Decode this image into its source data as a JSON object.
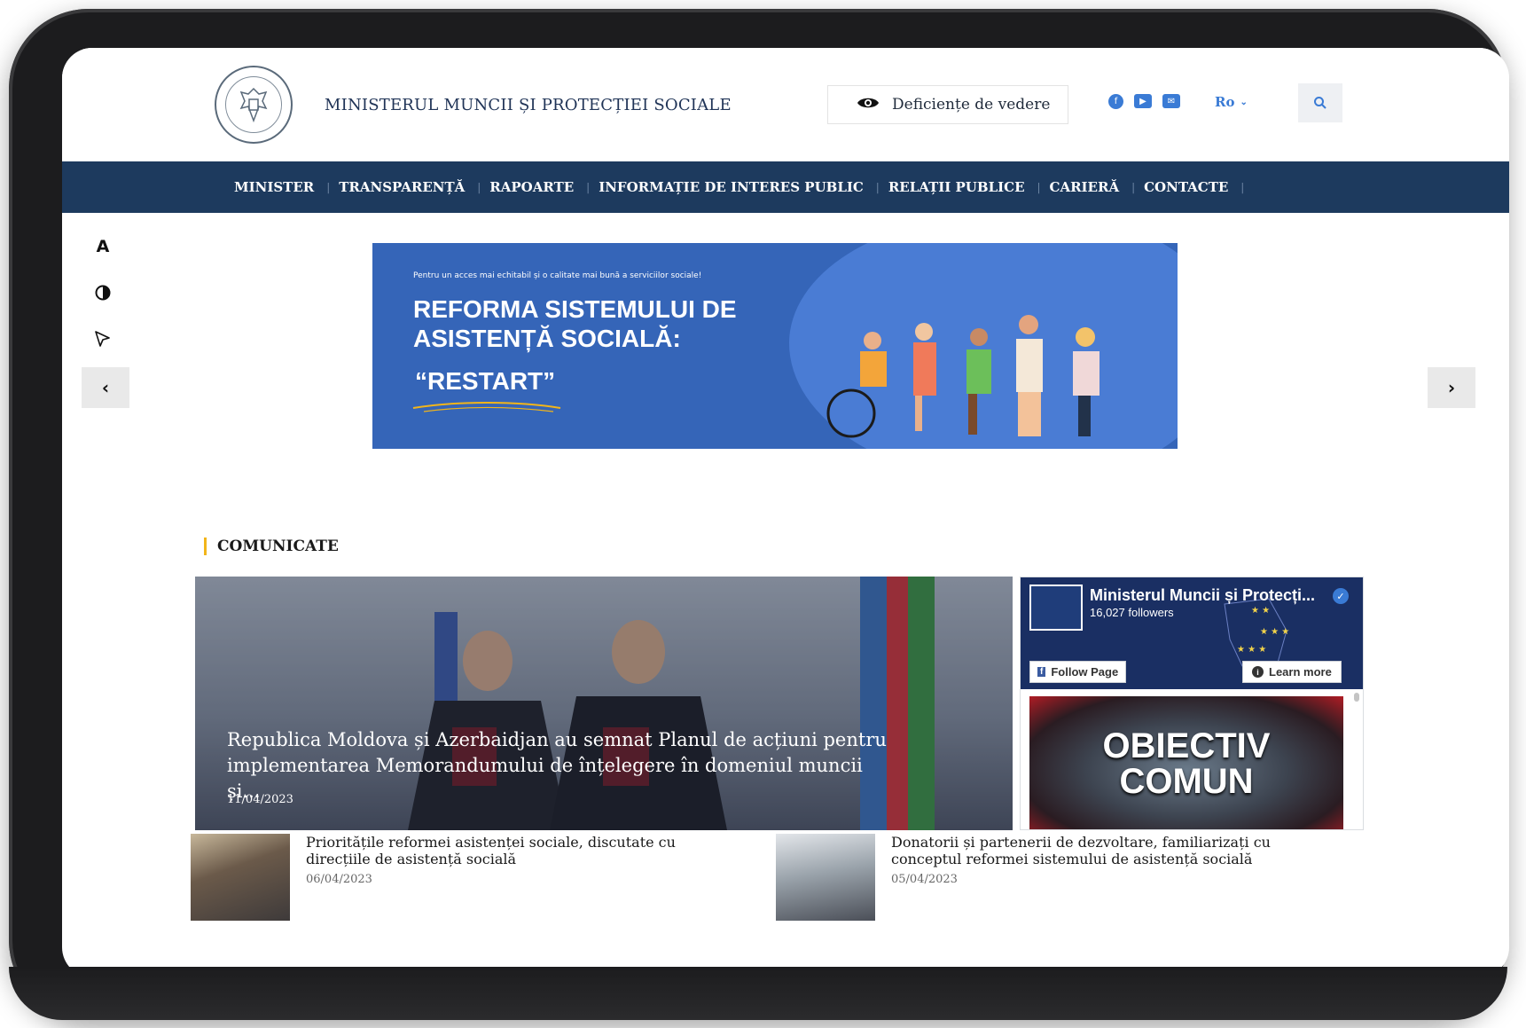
{
  "header": {
    "site_title": "MINISTERUL MUNCII ȘI PROTECȚIEI SOCIALE",
    "vision_label": "Deficiențe de vedere",
    "language": "Ro"
  },
  "nav": {
    "items": [
      "MINISTER",
      "TRANSPARENȚĂ",
      "RAPOARTE",
      "INFORMAȚIE DE INTERES PUBLIC",
      "RELAȚII PUBLICE",
      "CARIERĂ",
      "CONTACTE"
    ]
  },
  "tools": {
    "font_label": "A"
  },
  "banner": {
    "small_text": "Pentru un acces mai echitabil și o calitate mai bună a serviciilor sociale!",
    "title": "REFORMA SISTEMULUI DE ASISTENȚĂ SOCIALĂ:",
    "subtitle": "“RESTART”"
  },
  "section": {
    "title": "COMUNICATE"
  },
  "featured": {
    "title": "Republica Moldova și Azerbaidjan au semnat Planul de acțiuni pentru implementarea Memorandumului de înțelegere în domeniul muncii și...",
    "date": "11/04/2023"
  },
  "facebook": {
    "page_name": "Ministerul Muncii și Protecți...",
    "followers": "16,027 followers",
    "follow_label": "Follow Page",
    "learn_label": "Learn more",
    "video_line1": "OBIECTIV",
    "video_line2": "COMUN"
  },
  "news": [
    {
      "title": "Prioritățile reformei asistenței sociale, discutate cu direcțiile de asistență socială",
      "date": "06/04/2023"
    },
    {
      "title": "Donatorii și partenerii de dezvoltare, familiarizați cu conceptul reformei sistemului de asistență socială",
      "date": "05/04/2023"
    }
  ],
  "colors": {
    "nav_bg": "#1d3a5e",
    "accent": "#3a7bd5",
    "section_marker": "#f2b51a",
    "banner_bg": "#3565b8"
  }
}
